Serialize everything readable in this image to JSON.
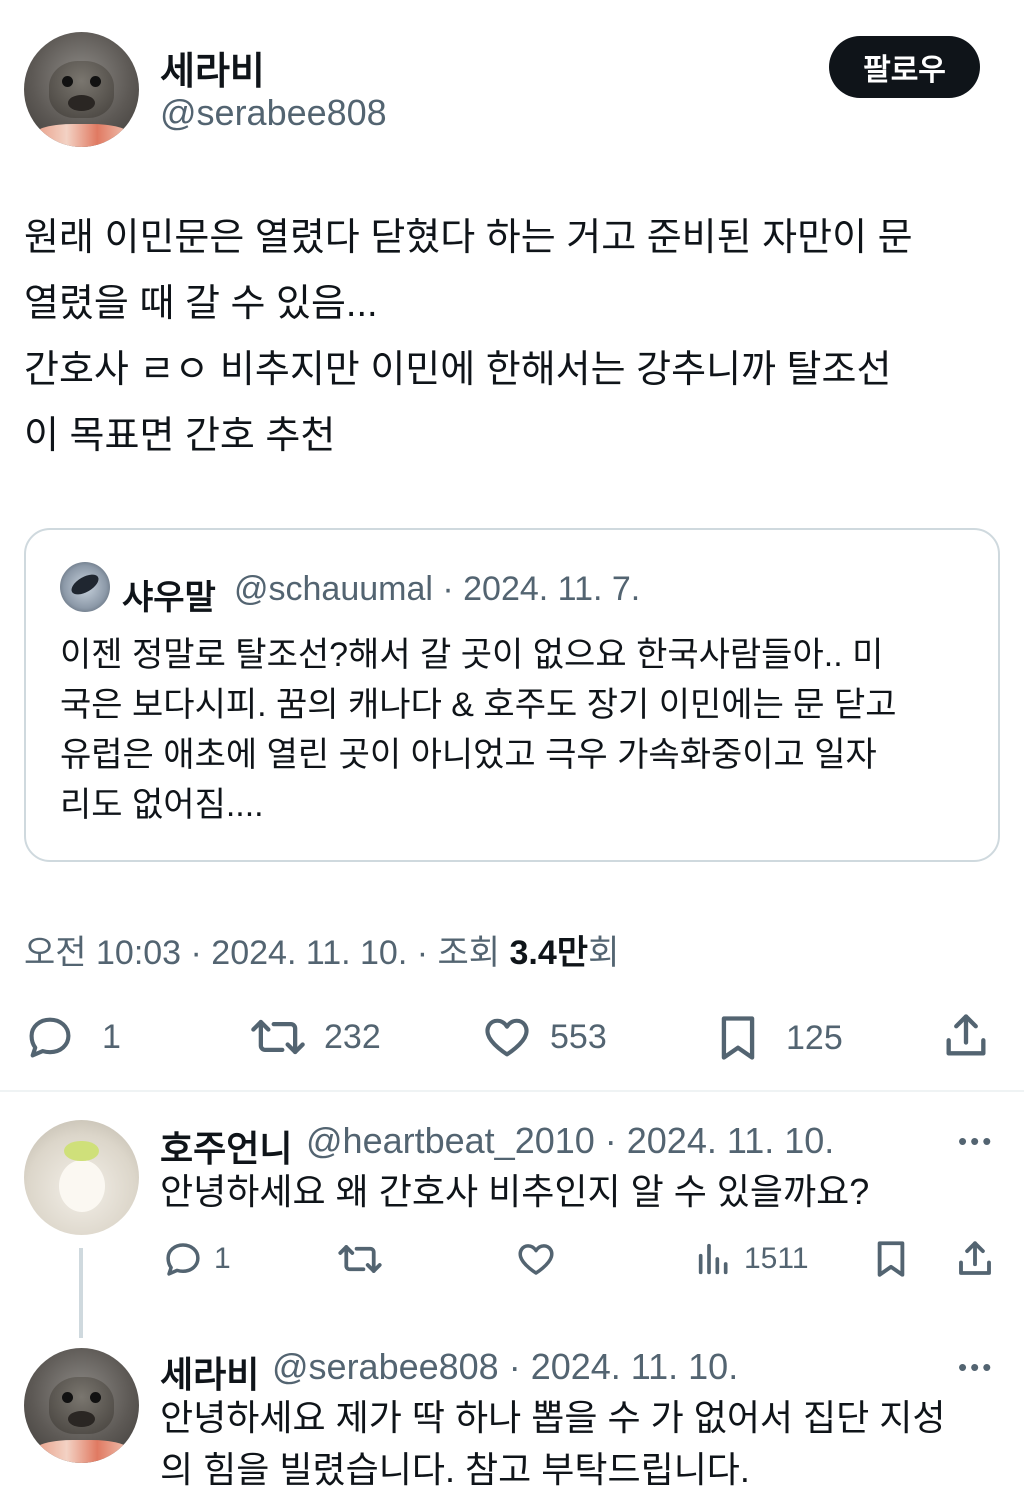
{
  "main_tweet": {
    "author_name": "세라비",
    "author_handle": "@serabee808",
    "follow_label": "팔로우",
    "body_lines": [
      "원래 이민문은 열렸다 닫혔다 하는 거고 준비된 자만이 문",
      "열렸을 때 갈 수 있음...",
      "간호사 ㄹㅇ 비추지만 이민에 한해서는 강추니까 탈조선",
      "이 목표면 간호 추천"
    ],
    "meta": {
      "time_date": "오전 10:03 · 2024. 11. 10. · 조회 ",
      "views": "3.4만",
      "views_suffix": "회"
    },
    "actions": {
      "replies": "1",
      "retweets": "232",
      "likes": "553",
      "bookmarks": "125"
    }
  },
  "quoted_tweet": {
    "author_name": "샤우말",
    "meta": "@schauumal · 2024. 11. 7.",
    "body_lines": [
      "이젠 정말로 탈조선?해서 갈 곳이 없으요 한국사람들아.. 미",
      "국은 보다시피. 꿈의 캐나다 & 호주도 장기 이민에는 문 닫고",
      "유럽은 애초에 열린 곳이 아니었고 극우 가속화중이고 일자",
      "리도 없어짐...."
    ]
  },
  "replies": [
    {
      "author_name": "호주언니",
      "meta": "@heartbeat_2010 · 2024. 11. 10.",
      "body_lines": [
        "안녕하세요 왜 간호사 비추인지 알 수 있을까요?"
      ],
      "replies": "1",
      "views": "1511",
      "more": "•••"
    },
    {
      "author_name": "세라비",
      "meta": "@serabee808 · 2024. 11. 10.",
      "body_lines": [
        "안녕하세요 제가 딱 하나 뽑을 수 가 없어서 집단 지성",
        "의 힘을 빌렸습니다. 참고 부탁드립니다."
      ],
      "more": "•••"
    }
  ],
  "icons": {
    "reply": "speech-bubble-icon",
    "retweet": "retweet-icon",
    "like": "heart-icon",
    "bookmark": "bookmark-icon",
    "share": "share-icon",
    "views": "bar-chart-icon"
  },
  "colors": {
    "text": "#0f1419",
    "secondary": "#536471",
    "border": "#cfd9de",
    "button_bg": "#0f1419"
  }
}
